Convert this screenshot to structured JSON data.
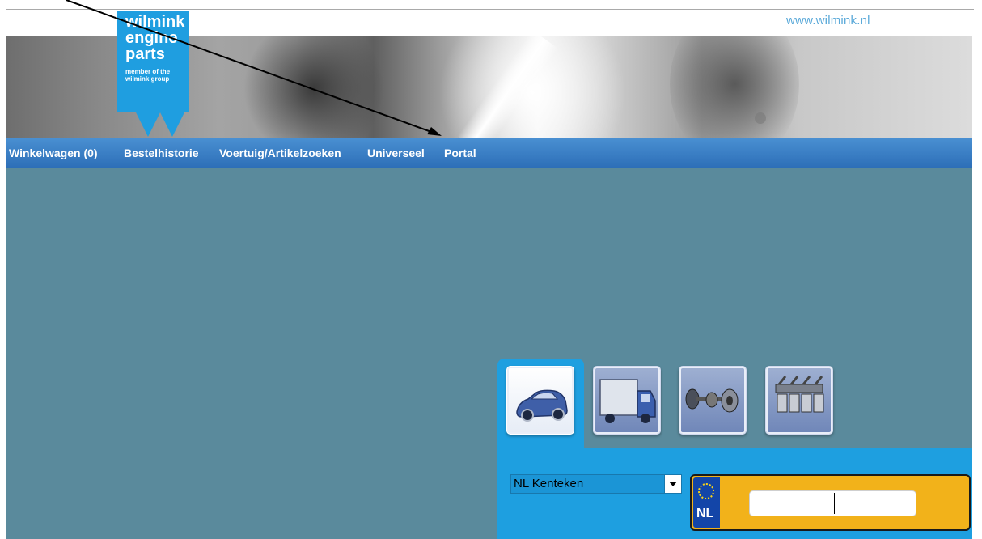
{
  "header": {
    "site_url": "www.wilmink.nl",
    "logo": {
      "line1": "wilmink",
      "line2": "engine",
      "line3": "parts",
      "tagline1": "member of the",
      "tagline2": "wilmink group"
    }
  },
  "nav": {
    "items": [
      {
        "label": "Winkelwagen (0)"
      },
      {
        "label": "Bestelhistorie"
      },
      {
        "label": "Voertuig/Artikelzoeken"
      },
      {
        "label": "Universeel"
      },
      {
        "label": "Portal"
      }
    ]
  },
  "search": {
    "tabs": [
      {
        "icon": "car-icon",
        "active": true
      },
      {
        "icon": "truck-icon",
        "active": false
      },
      {
        "icon": "axle-icon",
        "active": false
      },
      {
        "icon": "engine-icon",
        "active": false
      }
    ],
    "type_select": {
      "value": "NL Kenteken"
    },
    "plate": {
      "country": "NL",
      "value": ""
    }
  },
  "colors": {
    "brand_blue": "#1f9ee0",
    "nav_blue": "#2d6fb8",
    "background": "#5a8a9c",
    "plate_yellow": "#f2b21a"
  }
}
